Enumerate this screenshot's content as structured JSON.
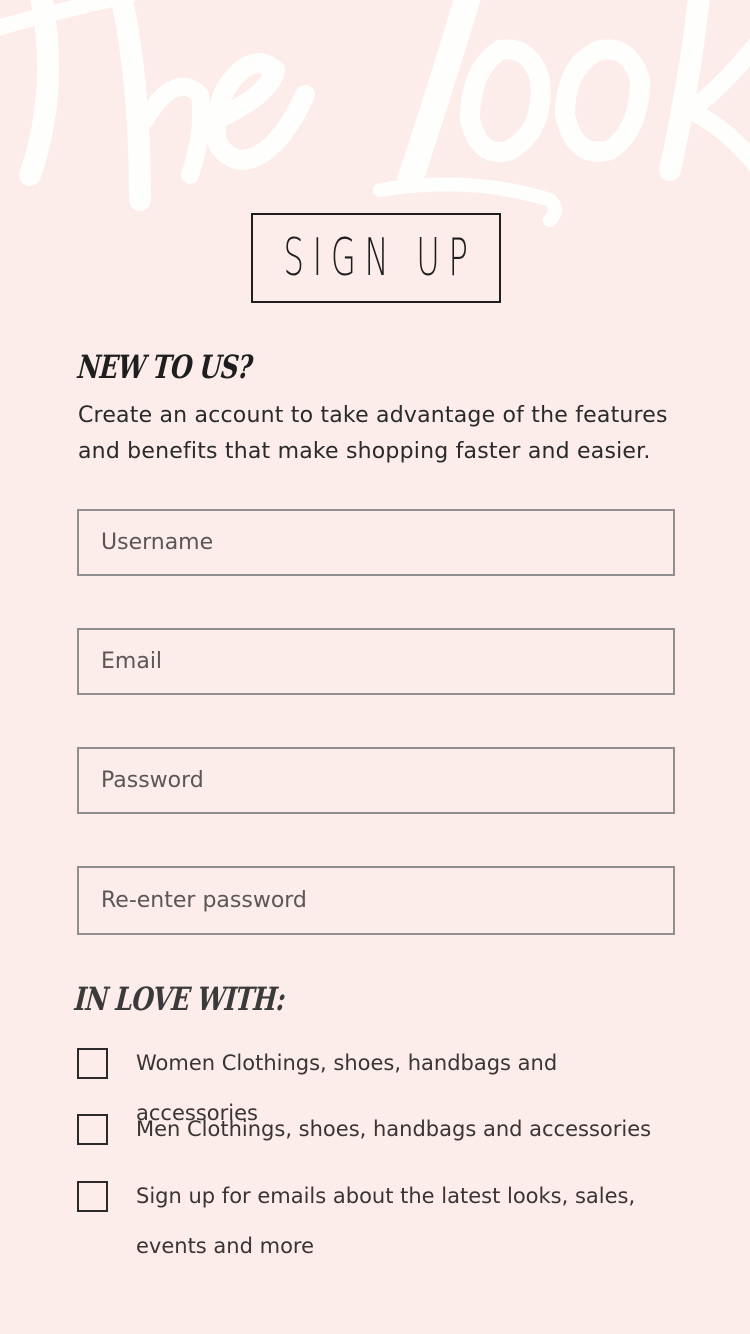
{
  "brand": {
    "watermark_text": "The Look",
    "background_color": "#fcecea",
    "watermark_color": "#ffffff"
  },
  "signup": {
    "title": "SIGN UP"
  },
  "intro": {
    "heading": "NEW TO US?",
    "body": "Create an account to take advantage of the features and benefits that make shopping faster and easier."
  },
  "form": {
    "username_placeholder": "Username",
    "email_placeholder": "Email",
    "password_placeholder": "Password",
    "repassword_placeholder": "Re-enter password"
  },
  "interests": {
    "heading": "IN LOVE WITH:",
    "options": [
      {
        "label": "Women Clothings, shoes, handbags and accessories",
        "checked": false
      },
      {
        "label": "Men Clothings, shoes, handbags and accessories",
        "checked": false
      },
      {
        "label": "Sign up for emails about the latest looks, sales, events and more",
        "checked": false
      }
    ]
  }
}
